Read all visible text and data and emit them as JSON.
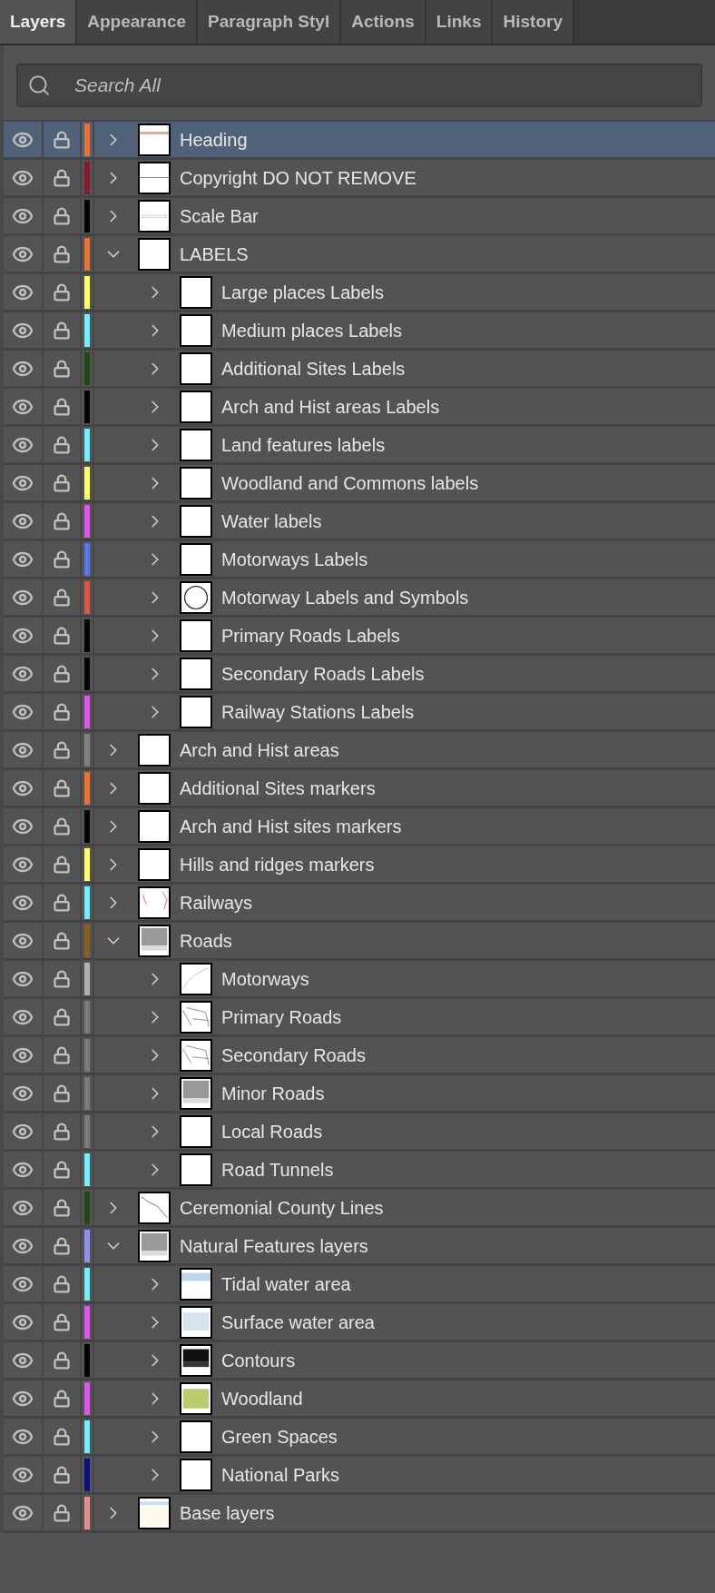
{
  "tabs": [
    {
      "label": "Layers",
      "selected": true
    },
    {
      "label": "Appearance",
      "selected": false
    },
    {
      "label": "Paragraph Styl",
      "selected": false
    },
    {
      "label": "Actions",
      "selected": false
    },
    {
      "label": "Links",
      "selected": false
    },
    {
      "label": "History",
      "selected": false
    }
  ],
  "search": {
    "placeholder": "Search All"
  },
  "layers": [
    {
      "name": "Heading",
      "color": "#f07030",
      "visible": true,
      "locked": true,
      "expanded": false,
      "selected": true
    },
    {
      "name": "Copyright DO NOT REMOVE",
      "color": "#8a1a30",
      "visible": true,
      "locked": true,
      "expanded": false,
      "selected": false
    },
    {
      "name": "Scale Bar",
      "color": "#000000",
      "visible": true,
      "locked": true,
      "expanded": false,
      "selected": false
    },
    {
      "name": "LABELS",
      "color": "#f07030",
      "visible": true,
      "locked": true,
      "expanded": true,
      "selected": false,
      "children": [
        {
          "name": "Large places Labels",
          "color": "#ffff66",
          "visible": true,
          "locked": true,
          "expanded": false,
          "selected": false
        },
        {
          "name": "Medium places Labels",
          "color": "#70f0ff",
          "visible": true,
          "locked": true,
          "expanded": false,
          "selected": false
        },
        {
          "name": "Additional Sites Labels",
          "color": "#1e4a14",
          "visible": true,
          "locked": true,
          "expanded": false,
          "selected": false
        },
        {
          "name": "Arch and Hist areas Labels",
          "color": "#000000",
          "visible": true,
          "locked": true,
          "expanded": false,
          "selected": false
        },
        {
          "name": "Land features labels",
          "color": "#70f0ff",
          "visible": true,
          "locked": true,
          "expanded": false,
          "selected": false
        },
        {
          "name": "Woodland and Commons labels",
          "color": "#ffff66",
          "visible": true,
          "locked": true,
          "expanded": false,
          "selected": false
        },
        {
          "name": "Water labels",
          "color": "#e055f0",
          "visible": true,
          "locked": true,
          "expanded": false,
          "selected": false
        },
        {
          "name": "Motorways Labels",
          "color": "#5577f0",
          "visible": true,
          "locked": true,
          "expanded": false,
          "selected": false
        },
        {
          "name": "Motorway Labels and Symbols",
          "color": "#e05545",
          "visible": true,
          "locked": true,
          "expanded": false,
          "selected": false
        },
        {
          "name": "Primary Roads Labels",
          "color": "#000000",
          "visible": true,
          "locked": true,
          "expanded": false,
          "selected": false
        },
        {
          "name": "Secondary Roads Labels",
          "color": "#000000",
          "visible": true,
          "locked": true,
          "expanded": false,
          "selected": false
        },
        {
          "name": "Railway Stations Labels",
          "color": "#e055f0",
          "visible": true,
          "locked": true,
          "expanded": false,
          "selected": false
        }
      ]
    },
    {
      "name": "Arch and Hist areas",
      "color": "#808080",
      "visible": true,
      "locked": true,
      "expanded": false,
      "selected": false
    },
    {
      "name": "Additional Sites markers",
      "color": "#f07030",
      "visible": true,
      "locked": true,
      "expanded": false,
      "selected": false
    },
    {
      "name": "Arch and Hist sites markers",
      "color": "#000000",
      "visible": true,
      "locked": true,
      "expanded": false,
      "selected": false
    },
    {
      "name": "Hills and ridges markers",
      "color": "#ffff66",
      "visible": true,
      "locked": true,
      "expanded": false,
      "selected": false
    },
    {
      "name": "Railways",
      "color": "#70f0ff",
      "visible": true,
      "locked": true,
      "expanded": false,
      "selected": false
    },
    {
      "name": "Roads",
      "color": "#8a6020",
      "visible": true,
      "locked": true,
      "expanded": true,
      "selected": false,
      "children": [
        {
          "name": "Motorways",
          "color": "#b0b0b0",
          "visible": true,
          "locked": true,
          "expanded": false,
          "selected": false
        },
        {
          "name": "Primary Roads",
          "color": "#7a7a7a",
          "visible": true,
          "locked": true,
          "expanded": false,
          "selected": false
        },
        {
          "name": "Secondary Roads",
          "color": "#7a7a7a",
          "visible": true,
          "locked": true,
          "expanded": false,
          "selected": false
        },
        {
          "name": "Minor Roads",
          "color": "#7a7a7a",
          "visible": true,
          "locked": true,
          "expanded": false,
          "selected": false
        },
        {
          "name": "Local Roads",
          "color": "#7a7a7a",
          "visible": true,
          "locked": true,
          "expanded": false,
          "selected": false
        },
        {
          "name": "Road Tunnels",
          "color": "#70f0ff",
          "visible": true,
          "locked": true,
          "expanded": false,
          "selected": false
        }
      ]
    },
    {
      "name": "Ceremonial County Lines",
      "color": "#1e4a14",
      "visible": true,
      "locked": true,
      "expanded": false,
      "selected": false
    },
    {
      "name": "Natural Features layers",
      "color": "#9090f0",
      "visible": true,
      "locked": true,
      "expanded": true,
      "selected": false,
      "children": [
        {
          "name": "Tidal water area",
          "color": "#70f0ff",
          "visible": true,
          "locked": true,
          "expanded": false,
          "selected": false
        },
        {
          "name": "Surface water area",
          "color": "#e055f0",
          "visible": true,
          "locked": true,
          "expanded": false,
          "selected": false
        },
        {
          "name": "Contours",
          "color": "#000000",
          "visible": true,
          "locked": true,
          "expanded": false,
          "selected": false
        },
        {
          "name": "Woodland",
          "color": "#e055f0",
          "visible": true,
          "locked": true,
          "expanded": false,
          "selected": false
        },
        {
          "name": "Green Spaces",
          "color": "#70f0ff",
          "visible": true,
          "locked": true,
          "expanded": false,
          "selected": false
        },
        {
          "name": "National Parks",
          "color": "#0a1080",
          "visible": true,
          "locked": true,
          "expanded": false,
          "selected": false
        }
      ]
    },
    {
      "name": "Base layers",
      "color": "#e89088",
      "visible": true,
      "locked": true,
      "expanded": false,
      "selected": false
    }
  ]
}
